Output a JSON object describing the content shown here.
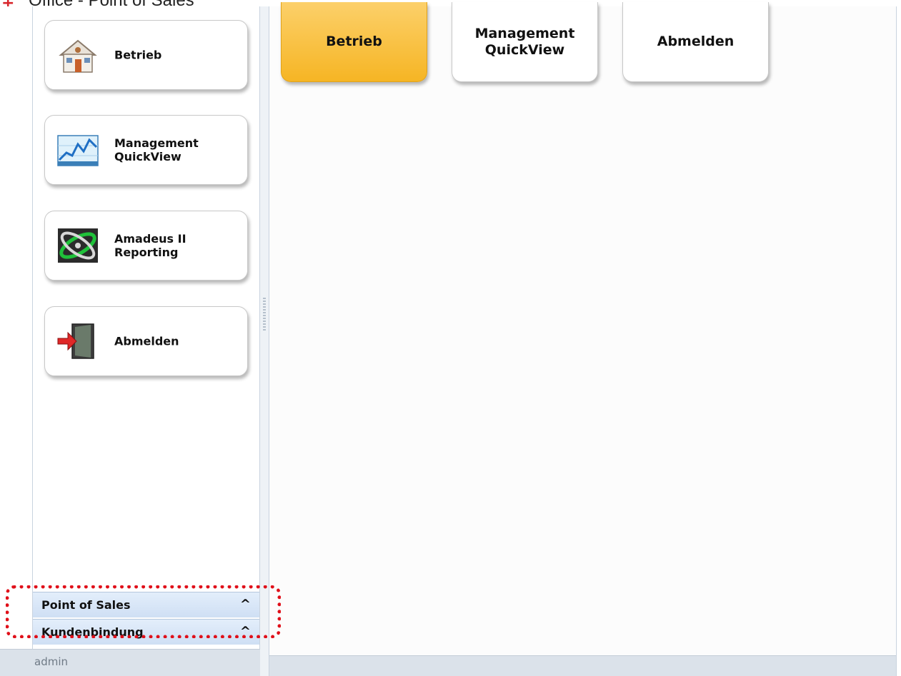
{
  "window": {
    "title": "Office - Point of Sales",
    "app_icon": "app-logo-icon"
  },
  "sidebar": {
    "items": [
      {
        "label": "Betrieb",
        "icon": "house-icon"
      },
      {
        "label": "Management\nQuickView",
        "icon": "line-chart-icon"
      },
      {
        "label": "Amadeus II\nReporting",
        "icon": "orbit-logo-icon"
      },
      {
        "label": "Abmelden",
        "icon": "logout-door-icon"
      }
    ],
    "sections": [
      {
        "label": "Point of Sales",
        "icon": "chevron-up-icon",
        "glyph": "^"
      },
      {
        "label": "Kundenbindung",
        "icon": "chevron-up-icon",
        "glyph": "^"
      }
    ],
    "user": "admin"
  },
  "main": {
    "tiles": [
      {
        "label": "Betrieb",
        "active": true
      },
      {
        "label": "Management\nQuickView",
        "active": false
      },
      {
        "label": "Abmelden",
        "active": false
      }
    ]
  },
  "colors": {
    "active_tile": "#f6b524",
    "section_bar": "#d6e4f6",
    "annotation": "#e0101a"
  }
}
